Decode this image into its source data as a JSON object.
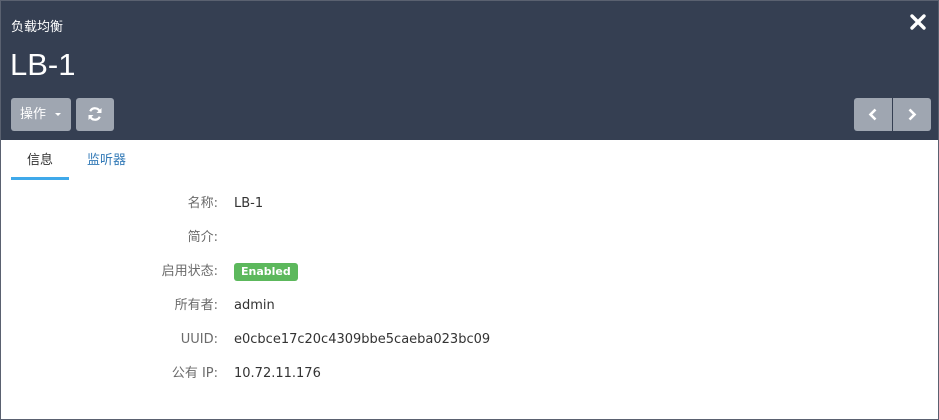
{
  "header": {
    "subtitle": "负载均衡",
    "title": "LB-1",
    "action_label": "操作"
  },
  "icons": {
    "close": "close-icon",
    "caret": "caret-down-icon",
    "refresh": "refresh-icon",
    "prev": "chevron-left-icon",
    "next": "chevron-right-icon"
  },
  "tabs": [
    {
      "label": "信息",
      "active": true
    },
    {
      "label": "监听器",
      "active": false
    }
  ],
  "details": [
    {
      "label": "名称:",
      "value": "LB-1"
    },
    {
      "label": "简介:",
      "value": ""
    },
    {
      "label": "启用状态:",
      "value": "Enabled"
    },
    {
      "label": "所有者:",
      "value": "admin"
    },
    {
      "label": "UUID:",
      "value": "e0cbce17c20c4309bbe5caeba023bc09"
    },
    {
      "label": "公有 IP:",
      "value": "10.72.11.176"
    }
  ],
  "colors": {
    "header_bg": "#353f52",
    "button_bg": "#9fa6b1",
    "tab_active_underline": "#3fa9ea",
    "link": "#337ab7",
    "status_enabled": "#5cb85c"
  }
}
